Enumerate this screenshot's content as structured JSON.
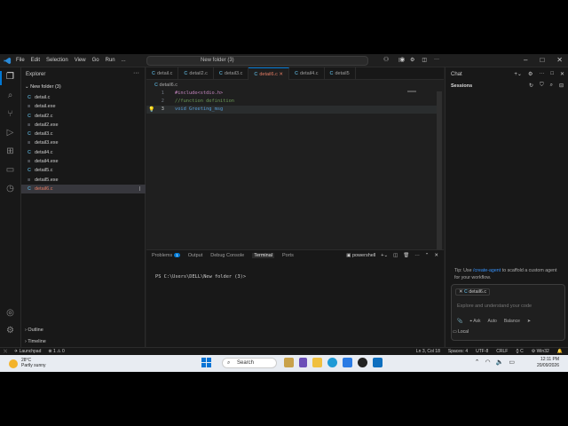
{
  "title": {
    "menu": [
      "File",
      "Edit",
      "Selection",
      "View",
      "Go",
      "Run",
      "..."
    ],
    "command_center": "New folder (3)"
  },
  "explorer": {
    "header": "Explorer",
    "folder": "New folder (3)",
    "files": [
      {
        "name": "detail.c",
        "kind": "c"
      },
      {
        "name": "detail.exe",
        "kind": "exe"
      },
      {
        "name": "detail2.c",
        "kind": "c"
      },
      {
        "name": "detail2.exe",
        "kind": "exe"
      },
      {
        "name": "detail3.c",
        "kind": "c"
      },
      {
        "name": "detail3.exe",
        "kind": "exe"
      },
      {
        "name": "detail4.c",
        "kind": "c"
      },
      {
        "name": "detail4.exe",
        "kind": "exe"
      },
      {
        "name": "detail5.c",
        "kind": "c"
      },
      {
        "name": "detail5.exe",
        "kind": "exe"
      },
      {
        "name": "detail6.c",
        "kind": "c",
        "selected": true
      }
    ],
    "outline": "Outline",
    "timeline": "Timeline"
  },
  "editor": {
    "tabs": [
      "detail.c",
      "detail2.c",
      "detail3.c",
      "detail6.c",
      "detail4.c",
      "detail5"
    ],
    "active_tab": "detail6.c",
    "breadcrumb": "detail6.c",
    "lines": [
      {
        "n": "1",
        "text": "#include<stdio.h>"
      },
      {
        "n": "2",
        "text": "//function definition"
      },
      {
        "n": "3",
        "text": "void Greeting_msg"
      }
    ]
  },
  "panel": {
    "tabs": [
      "Problems",
      "Output",
      "Debug Console",
      "Terminal",
      "Ports"
    ],
    "problems_badge": "1",
    "active": "Terminal",
    "shell": "powershell",
    "prompt": "PS C:\\Users\\DELL\\New folder (3)>"
  },
  "chat": {
    "title": "Chat",
    "sessions": "Sessions",
    "tip_prefix": "Tip: Use",
    "tip_command": "/create-agent",
    "tip_suffix": "to scaffold a custom agent for your workflow.",
    "context_chip": "detail6.c",
    "placeholder": "Explore and understand your code",
    "opts": [
      "Ask",
      "Auto",
      "Balance"
    ],
    "local": "Local"
  },
  "statusbar": {
    "launchpad": "Launchpad",
    "problems": "1",
    "warnings": "0",
    "position": "Ln 3, Col 18",
    "spaces": "Spaces: 4",
    "encoding": "UTF-8",
    "eol": "CRLF",
    "language": "C",
    "platform": "Win32"
  },
  "taskbar": {
    "temp": "28°C",
    "weather": "Partly sunny",
    "search": "Search",
    "time": "12:11 PM",
    "date": "20/09/2026"
  },
  "colors": {
    "accent": "#0078d4",
    "selected_file": "#e17b63",
    "c_icon": "#519aba"
  }
}
